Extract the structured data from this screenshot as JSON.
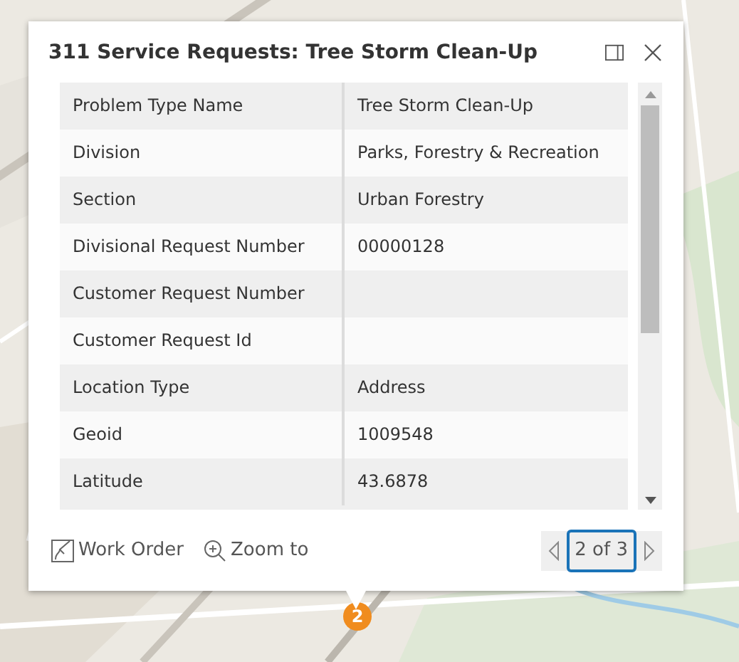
{
  "popup": {
    "title": "311 Service Requests: Tree Storm Clean-Up",
    "rows": [
      {
        "field": "Problem Type Name",
        "value": "Tree Storm Clean-Up"
      },
      {
        "field": "Division",
        "value": "Parks, Forestry & Recreation"
      },
      {
        "field": "Section",
        "value": "Urban Forestry"
      },
      {
        "field": "Divisional Request Number",
        "value": "00000128"
      },
      {
        "field": "Customer Request Number"
      },
      {
        "field": "Customer Request Id"
      },
      {
        "field": "Location Type",
        "value": "Address"
      },
      {
        "field": "Geoid",
        "value": "1009548"
      },
      {
        "field": "Latitude",
        "value": "43.6878"
      }
    ],
    "actions": [
      {
        "kind": "work-order",
        "label": "Work Order"
      },
      {
        "kind": "zoom",
        "label": "Zoom to"
      }
    ],
    "pager": "2 of 3"
  },
  "map": {
    "kind": "picture",
    "marker": "2"
  }
}
